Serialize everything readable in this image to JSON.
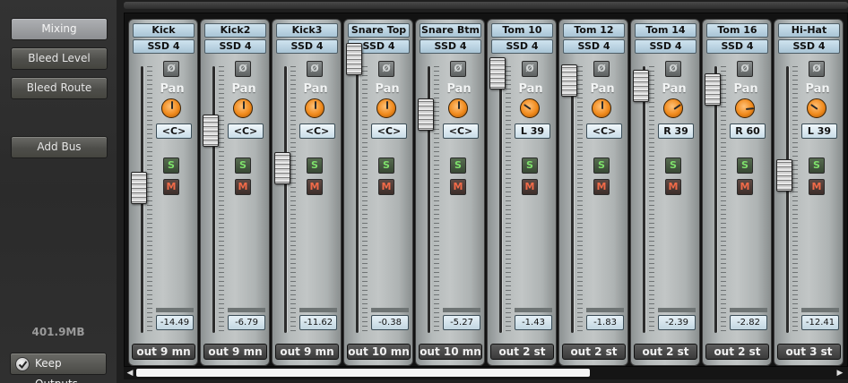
{
  "sidebar": {
    "buttons": [
      "Mixing",
      "Bleed Level",
      "Bleed Route"
    ],
    "add_bus": "Add Bus",
    "memory": "401.9MB",
    "keep_outputs": "Keep Outputs"
  },
  "channel_controls": {
    "phase_symbol": "Ø",
    "pan_label": "Pan",
    "solo_label": "S",
    "mute_label": "M"
  },
  "channels": [
    {
      "name": "Kick",
      "source": "SSD 4",
      "pan": "<C>",
      "level": "-14.49",
      "output": "out 9 mn"
    },
    {
      "name": "Kick2",
      "source": "SSD 4",
      "pan": "<C>",
      "level": "-6.79",
      "output": "out 9 mn"
    },
    {
      "name": "Kick3",
      "source": "SSD 4",
      "pan": "<C>",
      "level": "-11.62",
      "output": "out 9 mn"
    },
    {
      "name": "Snare Top",
      "source": "SSD 4",
      "pan": "<C>",
      "level": "-0.38",
      "output": "out 10 mn"
    },
    {
      "name": "Snare Btm",
      "source": "SSD 4",
      "pan": "<C>",
      "level": "-5.27",
      "output": "out 10 mn"
    },
    {
      "name": "Tom 10",
      "source": "SSD 4",
      "pan": "L 39",
      "level": "-1.43",
      "output": "out 2 st"
    },
    {
      "name": "Tom 12",
      "source": "SSD 4",
      "pan": "<C>",
      "level": "-1.83",
      "output": "out 2 st"
    },
    {
      "name": "Tom 14",
      "source": "SSD 4",
      "pan": "R 39",
      "level": "-2.39",
      "output": "out 2 st"
    },
    {
      "name": "Tom 16",
      "source": "SSD 4",
      "pan": "R 60",
      "level": "-2.82",
      "output": "out 2 st"
    },
    {
      "name": "Hi-Hat",
      "source": "SSD 4",
      "pan": "L 39",
      "level": "-12.41",
      "output": "out 3 st"
    }
  ],
  "scrollbar": {
    "left_arrow": "◀",
    "right_arrow": "▶"
  }
}
